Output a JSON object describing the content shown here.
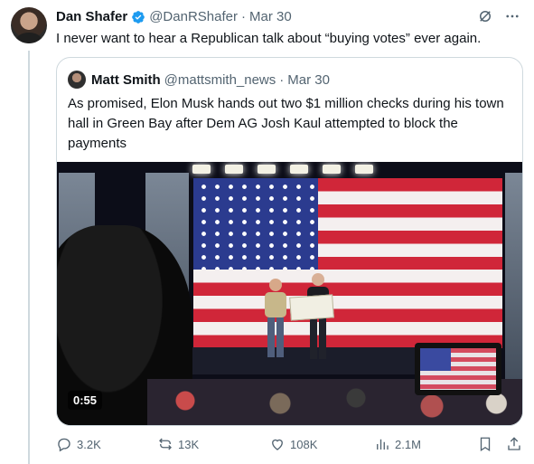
{
  "tweet": {
    "author_name": "Dan Shafer",
    "author_handle": "@DanRShafer",
    "separator": "·",
    "date": "Mar 30",
    "text": "I never want to hear a Republican talk about “buying votes” ever again."
  },
  "quoted": {
    "author_name": "Matt Smith",
    "author_handle": "@mattsmith_news",
    "separator": "·",
    "date": "Mar 30",
    "text": "As promised, Elon Musk hands out two $1 million checks during his town hall in Green Bay after Dem AG Josh Kaul attempted to block the payments",
    "video_duration": "0:55"
  },
  "actions": {
    "replies": "3.2K",
    "reposts": "13K",
    "likes": "108K",
    "views": "2.1M"
  },
  "colors": {
    "verified_badge": "#1d9bf0",
    "muted_text": "#536471",
    "border": "#cfd9de"
  }
}
